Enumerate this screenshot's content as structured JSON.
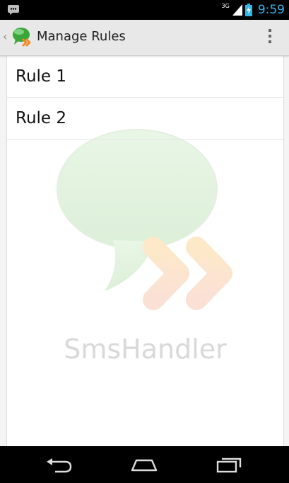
{
  "status_bar": {
    "network": "3G",
    "time": "9:59",
    "icons": [
      "message-notification-icon",
      "signal-icon",
      "battery-icon"
    ]
  },
  "action_bar": {
    "title": "Manage Rules",
    "app_icon": "smshandler-app-icon",
    "overflow_icon": "overflow-menu-icon"
  },
  "rules": [
    {
      "label": "Rule 1"
    },
    {
      "label": "Rule 2"
    }
  ],
  "watermark": {
    "text": "SmsHandler"
  },
  "nav_bar": {
    "icons": [
      "back-icon",
      "home-icon",
      "recent-apps-icon"
    ]
  },
  "colors": {
    "accent": "#33b5e5",
    "action_bar_bg": "#e8e8e8",
    "watermark_bubble": "#e3f3e0",
    "watermark_arrows": "#fce8cf"
  }
}
